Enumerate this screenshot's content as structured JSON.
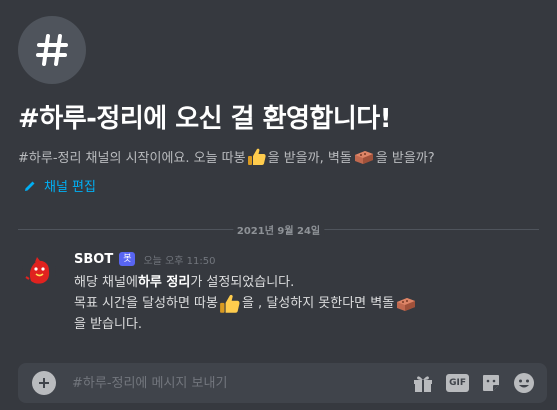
{
  "hero": {
    "hash_symbol": "#",
    "title": "#하루-정리에 오신 걸 환영합니다!",
    "subtitle_part1": "#하루-정리 채널의 시작이에요. 오늘 따봉",
    "subtitle_part2": "을 받을까, 벽돌",
    "subtitle_part3": "을 받을까?",
    "edit_label": "채널 편집"
  },
  "divider": {
    "date": "2021년 9월 24일"
  },
  "message": {
    "username": "SBOT",
    "bot_tag": "봇",
    "timestamp": "오늘 오후 11:50",
    "line1_pre": "해당 채널에 ",
    "line1_bold": "하루 정리",
    "line1_post": "가 설정되었습니다.",
    "line2_pre": "목표 시간을 달성하면 따봉",
    "line2_mid": "을 , 달성하지 못한다면 벽돌",
    "line3": "을 받습니다."
  },
  "composer": {
    "placeholder": "#하루-정리에 메시지 보내기",
    "gif_label": "GIF"
  },
  "icons": {
    "hash": "hash-icon",
    "pencil": "pencil-icon",
    "thumbs_up": "thumbs-up-icon",
    "brick": "brick-icon",
    "add": "plus-circle-icon",
    "gift": "gift-icon",
    "sticker": "sticker-icon",
    "emoji": "smiley-icon"
  },
  "colors": {
    "background": "#36393f",
    "link": "#00aff4",
    "bot_tag": "#5865f2",
    "composer": "#40444b"
  }
}
